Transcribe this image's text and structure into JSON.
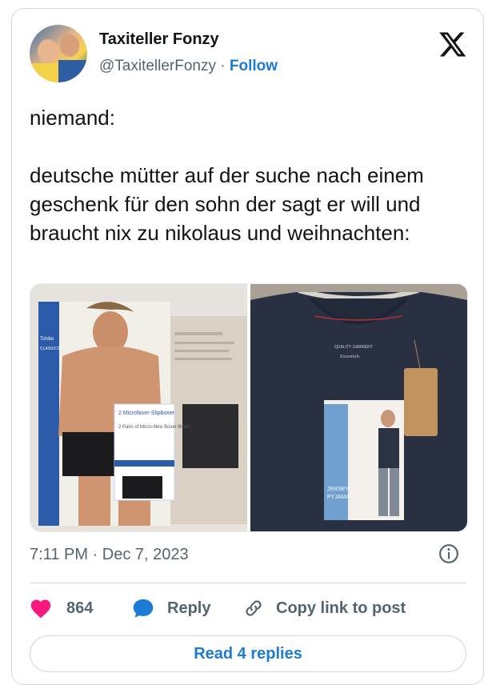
{
  "author": {
    "display_name": "Taxiteller Fonzy",
    "handle": "@TaxitellerFonzy",
    "separator": "·",
    "follow_label": "Follow"
  },
  "tweet": {
    "text": "niemand:\n\ndeutsche mütter auf der suche nach einem geschenk für den sohn der sagt er will und braucht nix zu nikolaus und weihnachten:",
    "timestamp": "7:11 PM · Dec 7, 2023"
  },
  "media": {
    "left_image": {
      "brand": "Tchibo",
      "line": "CLASSICS",
      "box_title": "2 Microfaser-Slipboxer",
      "box_subtitle": "2 Pairs of Micro-fibre Boxer Briefs"
    },
    "right_image": {
      "label_top": "QUALITY GARMENT",
      "label_brand": "Essentials",
      "box_text_1": "JERSEY",
      "box_text_2": "PYJAMA"
    }
  },
  "actions": {
    "like_count": "864",
    "reply_label": "Reply",
    "copy_label": "Copy link to post"
  },
  "read_replies_label": "Read 4 replies",
  "colors": {
    "accent": "#1d7bd8",
    "heart": "#f91880",
    "muted": "#536471",
    "border": "#cfd9de"
  }
}
